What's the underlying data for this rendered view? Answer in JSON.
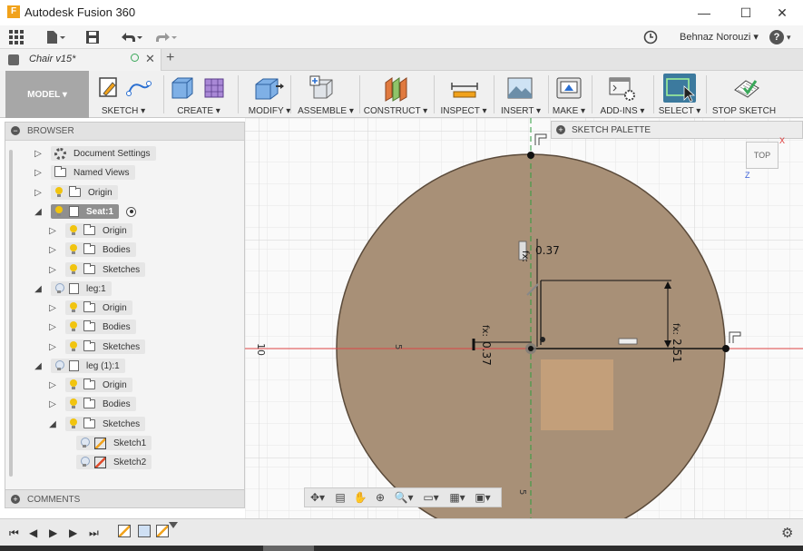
{
  "window": {
    "title": "Autodesk Fusion 360",
    "logo_letter": "F",
    "minimize": "—",
    "maximize": "☐",
    "close": "✕"
  },
  "quickbar": {
    "user": "Behnaz Norouzi ▾",
    "help": "?"
  },
  "tabs": {
    "document": "Chair v15*",
    "close": "✕",
    "add": "+"
  },
  "toolbar": {
    "workspace": "MODEL ▾",
    "groups": [
      "SKETCH ▾",
      "CREATE ▾",
      "MODIFY ▾",
      "ASSEMBLE ▾",
      "CONSTRUCT ▾",
      "INSPECT ▾",
      "INSERT ▾",
      "MAKE ▾",
      "ADD-INS ▾",
      "SELECT ▾",
      "STOP SKETCH"
    ]
  },
  "browser": {
    "title": "BROWSER",
    "toggle": "−",
    "items": [
      {
        "label": "Document Settings",
        "arrow": "▷"
      },
      {
        "label": "Named Views",
        "arrow": "▷"
      },
      {
        "label": "Origin",
        "arrow": "▷"
      },
      {
        "label": "Seat:1",
        "arrow": "◢"
      },
      {
        "label": "Origin",
        "arrow": "▷"
      },
      {
        "label": "Bodies",
        "arrow": "▷"
      },
      {
        "label": "Sketches",
        "arrow": "▷"
      },
      {
        "label": "leg:1",
        "arrow": "◢"
      },
      {
        "label": "Origin",
        "arrow": "▷"
      },
      {
        "label": "Bodies",
        "arrow": "▷"
      },
      {
        "label": "Sketches",
        "arrow": "▷"
      },
      {
        "label": "leg (1):1",
        "arrow": "◢"
      },
      {
        "label": "Origin",
        "arrow": "▷"
      },
      {
        "label": "Bodies",
        "arrow": "▷"
      },
      {
        "label": "Sketches",
        "arrow": "◢"
      },
      {
        "label": "Sketch1",
        "arrow": ""
      },
      {
        "label": "Sketch2",
        "arrow": ""
      }
    ]
  },
  "comments": {
    "title": "COMMENTS",
    "toggle": "+"
  },
  "palette": {
    "title": "SKETCH PALETTE",
    "toggle": "+"
  },
  "viewcube": {
    "face": "TOP",
    "axis_z": "Z",
    "axis_x": "X"
  },
  "canvas": {
    "dim_top": "0.37",
    "dim_left": "0.37",
    "dim_right": "2.51",
    "fx": "fx:",
    "ruler_10": "10",
    "ruler_5_left": "5",
    "ruler_5_bottom": "5"
  },
  "navbar": {
    "items": [
      "✥▾",
      "▤",
      "✋",
      "⊕",
      "🔍▾",
      "▭▾",
      "▦▾",
      "▣▾"
    ]
  },
  "timeline": {
    "first": "⏮",
    "prev": "◀",
    "play": "▶",
    "next": "▶",
    "last": "⏭",
    "settings": "⚙"
  },
  "colors": {
    "sketch_fill": "#a89077",
    "profile_fill": "#c8a27a",
    "select_active": "#3c7a9e",
    "workspace": "#a7a7a7"
  }
}
